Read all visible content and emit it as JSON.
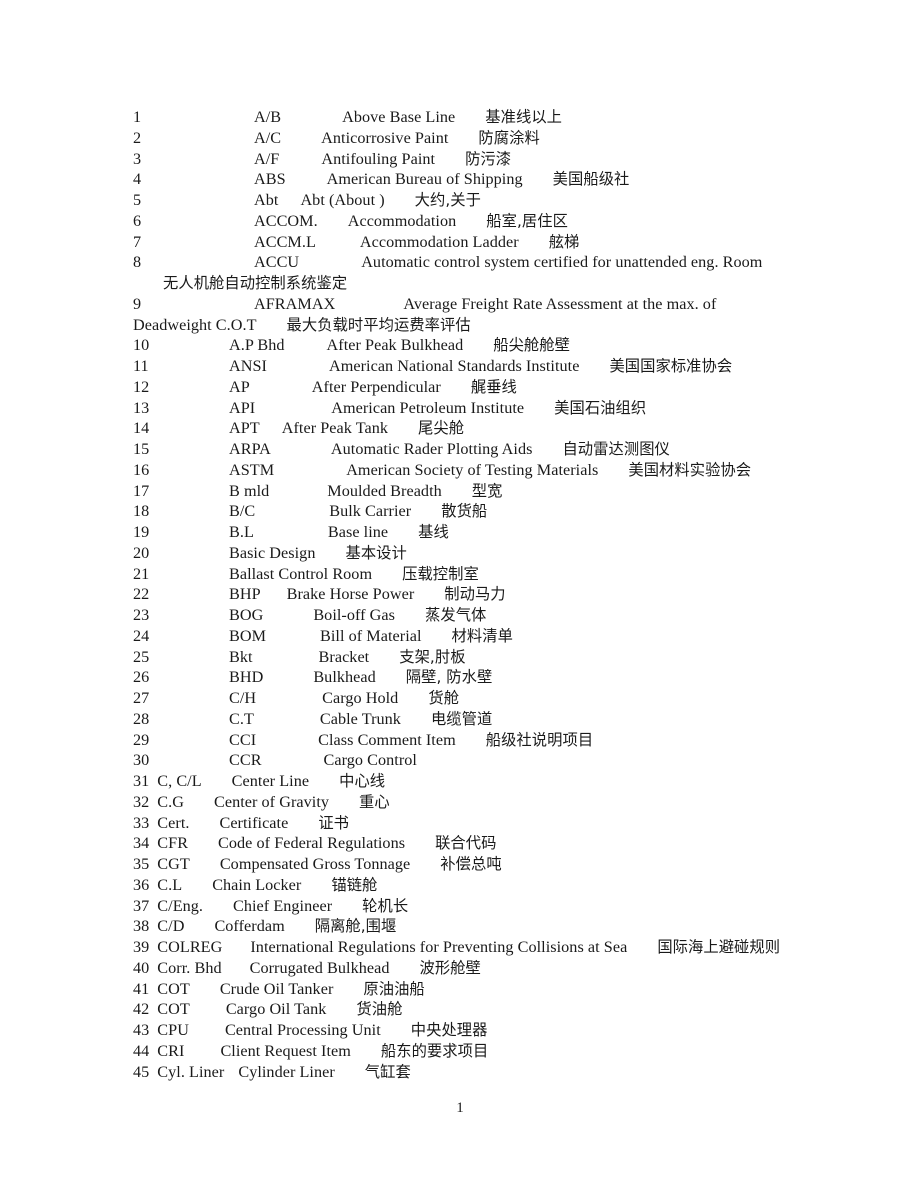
{
  "document": {
    "page_number": "1",
    "entries": [
      {
        "no": "1",
        "abbr": "A/B",
        "en": "Above Base Line",
        "cn": "基准线以上",
        "abbr_pad": 74,
        "en_pad": 61,
        "style": "wide"
      },
      {
        "no": "2",
        "abbr": "A/C",
        "en": "Anticorrosive Paint",
        "cn": "防腐涂料",
        "abbr_pad": 74,
        "en_pad": 40,
        "style": "wide"
      },
      {
        "no": "3",
        "abbr": "A/F",
        "en": "Antifouling Paint",
        "cn": "防污漆",
        "abbr_pad": 74,
        "en_pad": 42,
        "style": "wide"
      },
      {
        "no": "4",
        "abbr": "ABS",
        "en": "American Bureau of Shipping",
        "cn": "美国船级社",
        "abbr_pad": 74,
        "en_pad": 41,
        "style": "wide"
      },
      {
        "no": "5",
        "abbr": "Abt",
        "en": "Abt (About )",
        "cn": "大约,关于",
        "abbr_pad": 74,
        "en_pad": 22,
        "style": "wide"
      },
      {
        "no": "6",
        "abbr": "ACCOM.",
        "en": "Accommodation",
        "cn": "船室,居住区",
        "abbr_pad": 74,
        "en_pad": 30,
        "style": "wide"
      },
      {
        "no": "7",
        "abbr": "ACCM.L",
        "en": "Accommodation Ladder",
        "cn": "舷梯",
        "abbr_pad": 74,
        "en_pad": 44,
        "style": "wide"
      },
      {
        "no": "8",
        "abbr": "ACCU",
        "en": "Automatic control system certified for unattended eng. Room",
        "cn": "无人机舱自动控制系统鉴定",
        "abbr_pad": 74,
        "en_pad": 62,
        "style": "wrap"
      },
      {
        "no": "9",
        "abbr": "AFRAMAX",
        "en": "Average Freight Rate Assessment at the max. of Deadweight C.O.T",
        "cn": "最大负载时平均运费率评估",
        "abbr_pad": 74,
        "en_pad": 68,
        "style": "wrap"
      },
      {
        "no": "10",
        "abbr": "A.P Bhd",
        "en": "After Peak Bulkhead",
        "cn": "船尖舱舱壁",
        "abbr_pad": 49,
        "en_pad": 42,
        "style": "wide"
      },
      {
        "no": "11",
        "abbr": "ANSI",
        "en": "American National Standards Institute",
        "cn": "美国国家标准协会",
        "abbr_pad": 49,
        "en_pad": 62,
        "style": "wide"
      },
      {
        "no": "12",
        "abbr": "AP",
        "en": "After Perpendicular",
        "cn": "艉垂线",
        "abbr_pad": 49,
        "en_pad": 62,
        "style": "wide"
      },
      {
        "no": "13",
        "abbr": "API",
        "en": "American Petroleum Institute",
        "cn": "美国石油组织",
        "abbr_pad": 49,
        "en_pad": 76,
        "style": "wide"
      },
      {
        "no": "14",
        "abbr": "APT",
        "en": "After Peak Tank",
        "cn": "尾尖舱",
        "abbr_pad": 49,
        "en_pad": 22,
        "style": "wide"
      },
      {
        "no": "15",
        "abbr": "ARPA",
        "en": "Automatic Rader Plotting Aids",
        "cn": "自动雷达测图仪",
        "abbr_pad": 49,
        "en_pad": 60,
        "style": "wide"
      },
      {
        "no": "16",
        "abbr": "ASTM",
        "en": "American Society of Testing Materials",
        "cn": "美国材料实验协会",
        "abbr_pad": 49,
        "en_pad": 72,
        "style": "wide"
      },
      {
        "no": "17",
        "abbr": "B mld",
        "en": "Moulded Breadth",
        "cn": "型宽",
        "abbr_pad": 49,
        "en_pad": 58,
        "style": "wide"
      },
      {
        "no": "18",
        "abbr": "B/C",
        "en": "Bulk Carrier",
        "cn": "散货船",
        "abbr_pad": 49,
        "en_pad": 74,
        "style": "wide"
      },
      {
        "no": "19",
        "abbr": "B.L",
        "en": "Base line",
        "cn": "基线",
        "abbr_pad": 49,
        "en_pad": 74,
        "style": "wide"
      },
      {
        "no": "20",
        "abbr": "Basic Design",
        "en": "",
        "cn": "基本设计",
        "abbr_pad": 49,
        "en_pad": 0,
        "style": "wide"
      },
      {
        "no": "21",
        "abbr": "Ballast Control Room",
        "en": "",
        "cn": "压载控制室",
        "abbr_pad": 49,
        "en_pad": 0,
        "style": "wide"
      },
      {
        "no": "22",
        "abbr": "BHP",
        "en": "Brake Horse Power",
        "cn": "制动马力",
        "abbr_pad": 49,
        "en_pad": 26,
        "style": "wide"
      },
      {
        "no": "23",
        "abbr": "BOG",
        "en": "Boil-off Gas",
        "cn": "蒸发气体",
        "abbr_pad": 49,
        "en_pad": 50,
        "style": "wide"
      },
      {
        "no": "24",
        "abbr": "BOM",
        "en": "Bill of Material",
        "cn": "材料清单",
        "abbr_pad": 49,
        "en_pad": 54,
        "style": "wide"
      },
      {
        "no": "25",
        "abbr": "Bkt",
        "en": "Bracket",
        "cn": "支架,肘板",
        "abbr_pad": 49,
        "en_pad": 66,
        "style": "wide"
      },
      {
        "no": "26",
        "abbr": "BHD",
        "en": "Bulkhead",
        "cn": "隔壁, 防水壁",
        "abbr_pad": 49,
        "en_pad": 50,
        "style": "wide"
      },
      {
        "no": "27",
        "abbr": "C/H",
        "en": "Cargo Hold",
        "cn": "货舱",
        "abbr_pad": 49,
        "en_pad": 66,
        "style": "wide"
      },
      {
        "no": "28",
        "abbr": "C.T",
        "en": "Cable Trunk",
        "cn": "电缆管道",
        "abbr_pad": 49,
        "en_pad": 66,
        "style": "wide"
      },
      {
        "no": "29",
        "abbr": "CCI",
        "en": "Class Comment Item",
        "cn": "船级社说明项目",
        "abbr_pad": 49,
        "en_pad": 62,
        "style": "wide"
      },
      {
        "no": "30",
        "abbr": "CCR",
        "en": "Cargo Control",
        "cn": "",
        "abbr_pad": 49,
        "en_pad": 62,
        "style": "wide"
      },
      {
        "no": "31",
        "abbr": "C, C/L",
        "en": "Center Line",
        "cn": "中心线",
        "abbr_pad": 8,
        "en_pad": 30,
        "style": "tight"
      },
      {
        "no": "32",
        "abbr": "C.G",
        "en": "Center of Gravity",
        "cn": "重心",
        "abbr_pad": 8,
        "en_pad": 30,
        "style": "tight"
      },
      {
        "no": "33",
        "abbr": "Cert.",
        "en": "Certificate",
        "cn": "证书",
        "abbr_pad": 8,
        "en_pad": 30,
        "style": "tight"
      },
      {
        "no": "34",
        "abbr": "CFR",
        "en": "Code of Federal Regulations",
        "cn": "联合代码",
        "abbr_pad": 8,
        "en_pad": 30,
        "style": "tight"
      },
      {
        "no": "35",
        "abbr": "CGT",
        "en": "Compensated Gross Tonnage",
        "cn": "补偿总吨",
        "abbr_pad": 8,
        "en_pad": 30,
        "style": "tight"
      },
      {
        "no": "36",
        "abbr": "C.L",
        "en": "Chain Locker",
        "cn": "锚链舱",
        "abbr_pad": 8,
        "en_pad": 30,
        "style": "tight"
      },
      {
        "no": "37",
        "abbr": "C/Eng.",
        "en": "Chief Engineer",
        "cn": "轮机长",
        "abbr_pad": 8,
        "en_pad": 30,
        "style": "tight"
      },
      {
        "no": "38",
        "abbr": "C/D",
        "en": "Cofferdam",
        "cn": "隔离舱,围堰",
        "abbr_pad": 8,
        "en_pad": 30,
        "style": "tight"
      },
      {
        "no": "39",
        "abbr": "COLREG",
        "en": "International Regulations for Preventing Collisions at Sea",
        "cn": "国际海上避碰规则",
        "abbr_pad": 8,
        "en_pad": 28,
        "style": "tight"
      },
      {
        "no": "40",
        "abbr": "Corr. Bhd",
        "en": "Corrugated Bulkhead",
        "cn": "波形舱壁",
        "abbr_pad": 8,
        "en_pad": 28,
        "style": "tight"
      },
      {
        "no": "41",
        "abbr": "COT",
        "en": "Crude Oil Tanker",
        "cn": "原油油船",
        "abbr_pad": 8,
        "en_pad": 30,
        "style": "tight"
      },
      {
        "no": "42",
        "abbr": "COT",
        "en": "Cargo Oil Tank",
        "cn": "货油舱",
        "abbr_pad": 8,
        "en_pad": 36,
        "style": "tight"
      },
      {
        "no": "43",
        "abbr": "CPU",
        "en": "Central Processing Unit",
        "cn": "中央处理器",
        "abbr_pad": 8,
        "en_pad": 36,
        "style": "tight"
      },
      {
        "no": "44",
        "abbr": "CRI",
        "en": "Client Request Item",
        "cn": "船东的要求项目",
        "abbr_pad": 8,
        "en_pad": 36,
        "style": "tight"
      },
      {
        "no": "45",
        "abbr": "Cyl. Liner",
        "en": "Cylinder Liner",
        "cn": "气缸套",
        "abbr_pad": 8,
        "en_pad": 14,
        "style": "tight"
      }
    ]
  }
}
